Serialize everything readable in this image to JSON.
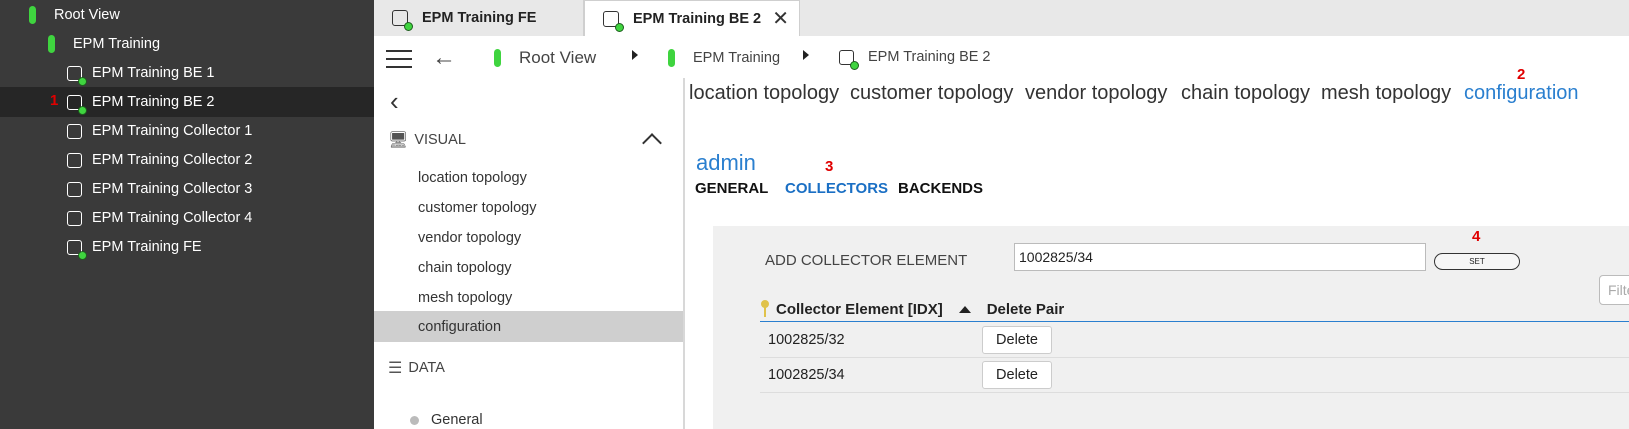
{
  "tree": {
    "items": [
      {
        "label": "Root View",
        "marker": ""
      },
      {
        "label": "EPM Training",
        "marker": ""
      },
      {
        "label": "EPM Training BE 1",
        "marker": ""
      },
      {
        "label": "EPM Training BE 2",
        "marker": "1"
      },
      {
        "label": "EPM Training Collector 1",
        "marker": ""
      },
      {
        "label": "EPM Training Collector 2",
        "marker": ""
      },
      {
        "label": "EPM Training Collector 3",
        "marker": ""
      },
      {
        "label": "EPM Training Collector 4",
        "marker": ""
      },
      {
        "label": "EPM Training FE",
        "marker": ""
      }
    ]
  },
  "tabs": [
    {
      "label": "EPM Training FE"
    },
    {
      "label": "EPM Training BE 2",
      "close": "✕"
    }
  ],
  "breadcrumb": {
    "items": [
      "Root View",
      "EPM Training",
      "EPM Training BE 2"
    ]
  },
  "menu": {
    "visual_header": "VISUAL",
    "visual_items": [
      "location topology",
      "customer topology",
      "vendor topology",
      "chain topology",
      "mesh topology",
      "configuration"
    ],
    "data_header": "DATA",
    "data_items": [
      "General"
    ]
  },
  "topology_tabs": [
    "location topology",
    "customer topology",
    "vendor topology",
    "chain topology",
    "mesh topology",
    "configuration"
  ],
  "markers": {
    "m2": "2",
    "m3": "3",
    "m4": "4"
  },
  "content": {
    "user": "admin",
    "subtabs": [
      "GENERAL",
      "COLLECTORS",
      "BACKENDS"
    ],
    "add_label": "ADD COLLECTOR ELEMENT",
    "add_value": "1002825/34",
    "set_label": "SET",
    "filter_placeholder": "Filter",
    "table": {
      "headers": [
        "Collector Element [IDX]",
        "Delete Pair"
      ],
      "rows": [
        {
          "element": "1002825/32",
          "action": "Delete"
        },
        {
          "element": "1002825/34",
          "action": "Delete"
        }
      ]
    }
  },
  "colors": {
    "accent": "#2a7fcf",
    "status_green": "#3fd43f",
    "marker_red": "#e00000",
    "tree_bg": "#3a3a3a"
  }
}
